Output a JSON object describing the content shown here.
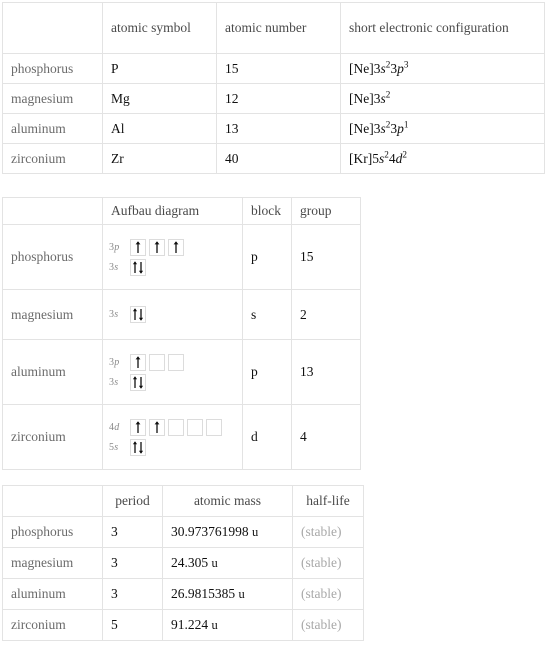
{
  "tables": [
    {
      "id": "elements",
      "name": "element-properties-table",
      "headers": [
        "",
        "atomic symbol",
        "atomic number",
        "short electronic configuration"
      ],
      "rows": [
        {
          "label": "phosphorus",
          "symbol": "P",
          "number": "15",
          "config": {
            "core": "[Ne]",
            "terms": [
              {
                "n": "3",
                "orbital": "s",
                "count": "2"
              },
              {
                "n": "3",
                "orbital": "p",
                "count": "3"
              }
            ]
          }
        },
        {
          "label": "magnesium",
          "symbol": "Mg",
          "number": "12",
          "config": {
            "core": "[Ne]",
            "terms": [
              {
                "n": "3",
                "orbital": "s",
                "count": "2"
              }
            ]
          }
        },
        {
          "label": "aluminum",
          "symbol": "Al",
          "number": "13",
          "config": {
            "core": "[Ne]",
            "terms": [
              {
                "n": "3",
                "orbital": "s",
                "count": "2"
              },
              {
                "n": "3",
                "orbital": "p",
                "count": "1"
              }
            ]
          }
        },
        {
          "label": "zirconium",
          "symbol": "Zr",
          "number": "40",
          "config": {
            "core": "[Kr]",
            "terms": [
              {
                "n": "5",
                "orbital": "s",
                "count": "2"
              },
              {
                "n": "4",
                "orbital": "d",
                "count": "2"
              }
            ]
          }
        }
      ]
    },
    {
      "id": "aufbau",
      "name": "aufbau-diagram-table",
      "headers": [
        "",
        "Aufbau diagram",
        "block",
        "group"
      ],
      "rows": [
        {
          "label": "phosphorus",
          "block": "p",
          "group": "15",
          "aufbau": [
            {
              "n": "3",
              "orbital": "p",
              "boxes": [
                "up",
                "up",
                "up"
              ]
            },
            {
              "n": "3",
              "orbital": "s",
              "boxes": [
                "updown"
              ]
            }
          ]
        },
        {
          "label": "magnesium",
          "block": "s",
          "group": "2",
          "aufbau": [
            {
              "n": "3",
              "orbital": "s",
              "boxes": [
                "updown"
              ]
            }
          ]
        },
        {
          "label": "aluminum",
          "block": "p",
          "group": "13",
          "aufbau": [
            {
              "n": "3",
              "orbital": "p",
              "boxes": [
                "up",
                "empty",
                "empty"
              ]
            },
            {
              "n": "3",
              "orbital": "s",
              "boxes": [
                "updown"
              ]
            }
          ]
        },
        {
          "label": "zirconium",
          "block": "d",
          "group": "4",
          "aufbau": [
            {
              "n": "4",
              "orbital": "d",
              "boxes": [
                "up",
                "up",
                "empty",
                "empty",
                "empty"
              ]
            },
            {
              "n": "5",
              "orbital": "s",
              "boxes": [
                "updown"
              ]
            }
          ]
        }
      ]
    },
    {
      "id": "props",
      "name": "period-mass-halflife-table",
      "headers": [
        "",
        "period",
        "atomic mass",
        "half-life"
      ],
      "rows": [
        {
          "label": "phosphorus",
          "period": "3",
          "mass": "30.973761998",
          "mass_unit": "u",
          "halflife": "(stable)"
        },
        {
          "label": "magnesium",
          "period": "3",
          "mass": "24.305",
          "mass_unit": "u",
          "halflife": "(stable)"
        },
        {
          "label": "aluminum",
          "period": "3",
          "mass": "26.9815385",
          "mass_unit": "u",
          "halflife": "(stable)"
        },
        {
          "label": "zirconium",
          "period": "5",
          "mass": "91.224",
          "mass_unit": "u",
          "halflife": "(stable)"
        }
      ]
    }
  ],
  "colors": {
    "border": "#e3e3e3",
    "header_text": "#4a4a4a",
    "row_label_text": "#6b6b6b",
    "value_text": "#101010",
    "muted_text": "#a8a8a8",
    "orbital_label_text": "#8a8a8a",
    "orbital_box_border": "#dcdcdc",
    "arrow": "#111111",
    "background": "#ffffff"
  }
}
